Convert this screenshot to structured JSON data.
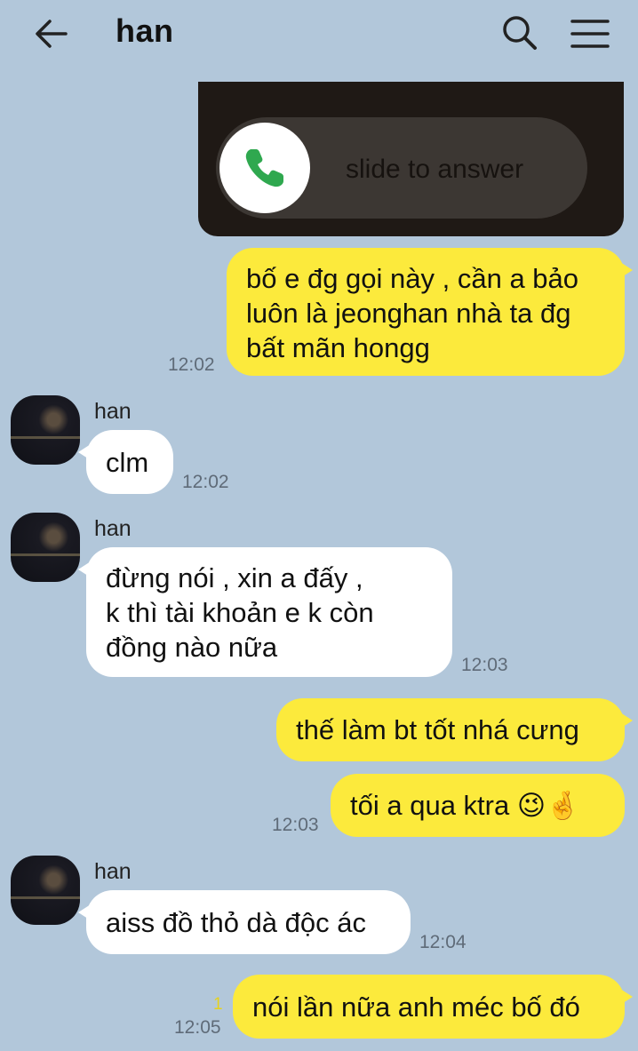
{
  "header": {
    "title": "han",
    "icons": [
      "back-arrow-icon",
      "search-icon",
      "menu-icon"
    ]
  },
  "image_card": {
    "slider_text": "slide to answer",
    "icon": "phone-icon"
  },
  "messages": [
    {
      "from": "me",
      "lines": [
        "bố e đg gọi này , cần a bảo",
        "luôn là jeonghan nhà ta đg",
        "bất mãn hongg"
      ],
      "time": "12:02"
    },
    {
      "from": "han",
      "sender_name": "han",
      "lines": [
        "clm"
      ],
      "time": "12:02"
    },
    {
      "from": "han",
      "sender_name": "han",
      "lines": [
        "đừng nói , xin a đấy ,",
        "k thì tài khoản e k còn",
        "đồng nào nữa"
      ],
      "time": "12:03"
    },
    {
      "from": "me",
      "lines": [
        "thế làm bt tốt nhá cưng"
      ]
    },
    {
      "from": "me",
      "lines": [
        "tối a qua ktra 😉🤞"
      ],
      "time": "12:03"
    },
    {
      "from": "han",
      "sender_name": "han",
      "lines": [
        "aiss đồ thỏ dà độc ác"
      ],
      "time": "12:04"
    },
    {
      "from": "me",
      "lines": [
        "nói lần nữa anh méc bố đó"
      ],
      "time": "12:05",
      "unread_count": "1"
    }
  ],
  "colors": {
    "background": "#b2c7da",
    "my_bubble": "#fcea3c",
    "their_bubble": "#ffffff",
    "timestamp": "#5f6b78",
    "unread": "#e6d21d"
  }
}
